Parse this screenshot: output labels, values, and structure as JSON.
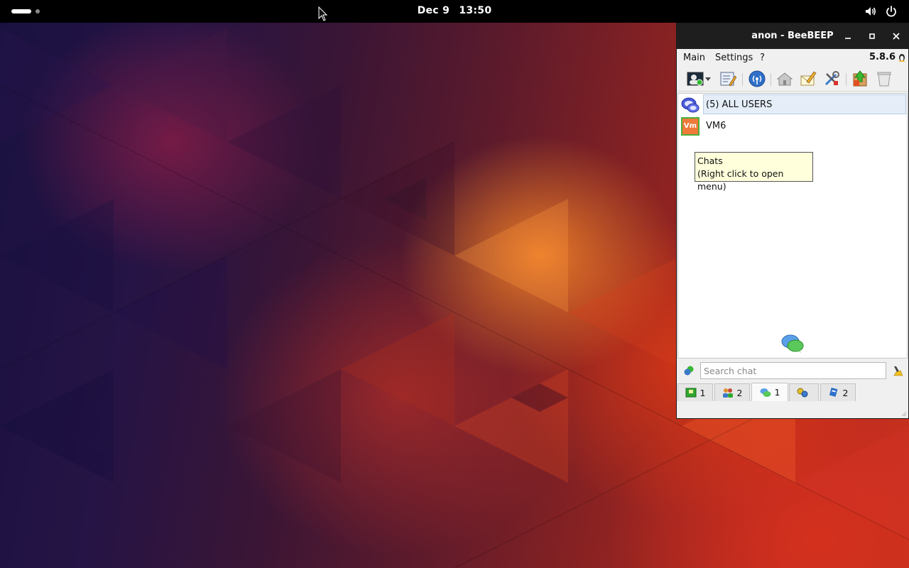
{
  "topbar": {
    "date": "Dec 9",
    "time": "13:50",
    "icons": [
      "volume-icon",
      "power-icon"
    ]
  },
  "window": {
    "title": "anon - BeeBEEP",
    "controls": [
      "minimize-icon",
      "maximize-icon",
      "close-icon"
    ]
  },
  "menu": {
    "main": "Main",
    "settings": "Settings",
    "help": "?",
    "version": "5.8.6"
  },
  "toolbar": {
    "icons": [
      "status-icon",
      "dropdown-arrow-icon",
      "edit-profile-icon",
      "network-icon",
      "home-icon",
      "write-note-icon",
      "tools-icon",
      "update-icon",
      "trash-icon"
    ]
  },
  "users": [
    {
      "name": "(5) ALL USERS",
      "icon": "group-chat-icon"
    },
    {
      "name": "VM6",
      "avatar_text": "Vm",
      "icon": "user-avatar-icon"
    }
  ],
  "tooltip": {
    "line1": "Chats",
    "line2": "(Right click to open menu)"
  },
  "search": {
    "placeholder": "Search chat"
  },
  "tabs": [
    {
      "count": "1",
      "icon": "users-tab-icon"
    },
    {
      "count": "2",
      "icon": "groups-tab-icon"
    },
    {
      "count": "1",
      "icon": "chats-tab-icon"
    },
    {
      "count": "",
      "icon": "plugins-tab-icon"
    },
    {
      "count": "2",
      "icon": "files-tab-icon"
    }
  ],
  "colors": {
    "avatar_bg": "#f07a3a",
    "avatar_border": "#4caf3a",
    "tooltip_bg": "#ffffdc",
    "titlebar": "#1e1e1e"
  }
}
